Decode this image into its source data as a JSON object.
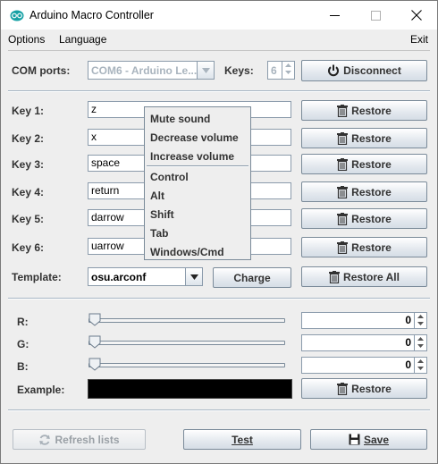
{
  "window": {
    "title": "Arduino Macro Controller",
    "controls": {
      "minimize": "—",
      "maximize": "☐",
      "close": "✕"
    }
  },
  "menubar": {
    "options": "Options",
    "language": "Language",
    "exit": "Exit"
  },
  "connection": {
    "com_label": "COM ports:",
    "com_value": "COM6 - Arduino Le...",
    "keys_label": "Keys:",
    "keys_value": "6",
    "disconnect_label": "Disconnect"
  },
  "keys": [
    {
      "label": "Key 1:",
      "value": "z"
    },
    {
      "label": "Key 2:",
      "value": "x"
    },
    {
      "label": "Key 3:",
      "value": "space"
    },
    {
      "label": "Key 4:",
      "value": "return"
    },
    {
      "label": "Key 5:",
      "value": "darrow"
    },
    {
      "label": "Key 6:",
      "value": "uarrow"
    }
  ],
  "restore_label": "Restore",
  "template": {
    "label": "Template:",
    "value": "osu.arconf",
    "charge_label": "Charge",
    "restore_all_label": "Restore All"
  },
  "popup_menu": {
    "items": [
      "Mute sound",
      "Decrease volume",
      "Increase volume",
      "Control",
      "Alt",
      "Shift",
      "Tab",
      "Windows/Cmd"
    ]
  },
  "color": {
    "r_label": "R:",
    "r_value": "0",
    "g_label": "G:",
    "g_value": "0",
    "b_label": "B:",
    "b_value": "0",
    "example_label": "Example:",
    "example_color": "#000000"
  },
  "footer": {
    "refresh_label": "Refresh lists",
    "test_label": "Test",
    "save_label": "Save"
  }
}
